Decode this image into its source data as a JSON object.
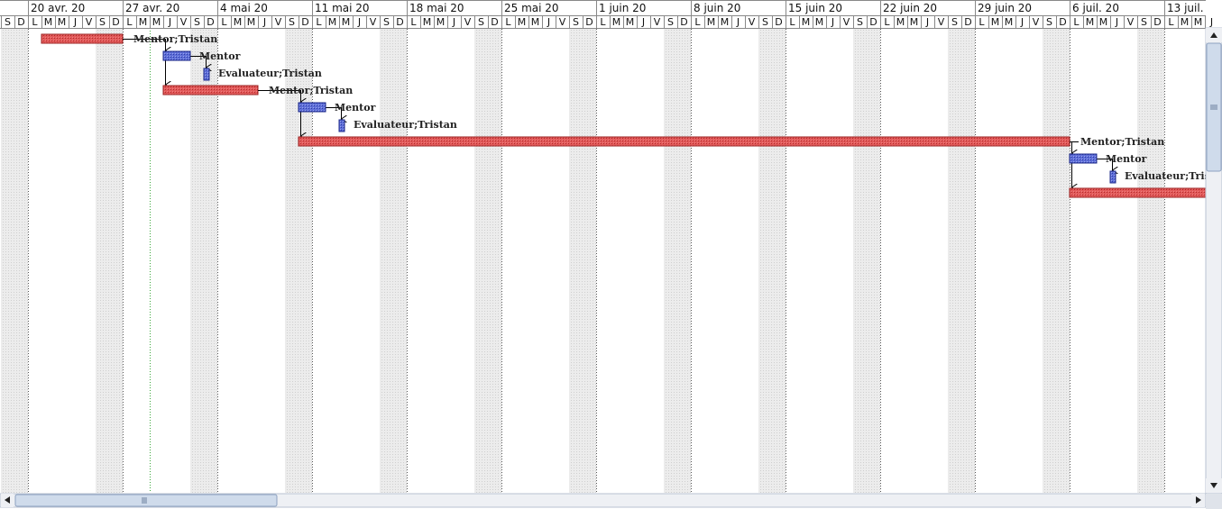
{
  "timeline": {
    "weeks": [
      "20 avr. 20",
      "27 avr. 20",
      "4 mai 20",
      "11 mai 20",
      "18 mai 20",
      "25 mai 20",
      "1 juin 20",
      "8 juin 20",
      "15 juin 20",
      "22 juin 20",
      "29 juin 20",
      "6 juil. 20",
      "13 juil."
    ],
    "day_letters": [
      "L",
      "M",
      "M",
      "J",
      "V",
      "S",
      "D"
    ],
    "leading_days": [
      "S",
      "D"
    ],
    "today_date": "2020-04-29"
  },
  "tasks": [
    {
      "id": "t1",
      "kind": "task",
      "start": "2020-04-21",
      "end": "2020-04-26",
      "label": "Mentor;Tristan",
      "color": "#d44040"
    },
    {
      "id": "t2",
      "kind": "review",
      "start": "2020-04-30",
      "end": "2020-05-01",
      "label": "Mentor",
      "color": "#3f4fc0"
    },
    {
      "id": "t3",
      "kind": "milestone",
      "start": "2020-05-03",
      "end": "2020-05-03",
      "label": "Evaluateur;Tristan",
      "color": "#3f4fc0"
    },
    {
      "id": "t4",
      "kind": "task",
      "start": "2020-04-30",
      "end": "2020-05-06",
      "label": "Mentor;Tristan",
      "color": "#d44040"
    },
    {
      "id": "t5",
      "kind": "review",
      "start": "2020-05-10",
      "end": "2020-05-11",
      "label": "Mentor",
      "color": "#3f4fc0"
    },
    {
      "id": "t6",
      "kind": "milestone",
      "start": "2020-05-13",
      "end": "2020-05-13",
      "label": "Evaluateur;Tristan",
      "color": "#3f4fc0"
    },
    {
      "id": "t7",
      "kind": "task",
      "start": "2020-05-10",
      "end": "2020-07-05",
      "label": "Mentor;Tristan",
      "color": "#d44040"
    },
    {
      "id": "t8",
      "kind": "review",
      "start": "2020-07-06",
      "end": "2020-07-07",
      "label": "Mentor",
      "color": "#3f4fc0"
    },
    {
      "id": "t9",
      "kind": "milestone",
      "start": "2020-07-09",
      "end": "2020-07-09",
      "label": "Evaluateur;Tristan",
      "color": "#3f4fc0"
    },
    {
      "id": "t10",
      "kind": "task",
      "start": "2020-07-06",
      "end": "2020-08-31",
      "label": "",
      "color": "#d44040"
    }
  ],
  "dependencies": [
    [
      "t1",
      "t2"
    ],
    [
      "t2",
      "t3"
    ],
    [
      "t1",
      "t4"
    ],
    [
      "t4",
      "t5"
    ],
    [
      "t5",
      "t6"
    ],
    [
      "t4",
      "t7"
    ],
    [
      "t7",
      "t8"
    ],
    [
      "t8",
      "t9"
    ],
    [
      "t7",
      "t10"
    ]
  ],
  "colors": {
    "grid": "#9a9a9a",
    "weekend": "#e6e6e6",
    "today_line": "#3aa83a",
    "scroll_bg": "#eef0f4",
    "scroll_thumb": "#cfdbeb",
    "scroll_border": "#8ea2c0"
  },
  "icons": {
    "scroll_up": "triangle-up-icon",
    "scroll_down": "triangle-down-icon",
    "scroll_left": "triangle-left-icon",
    "scroll_right": "triangle-right-icon",
    "grip": "grip-icon"
  }
}
